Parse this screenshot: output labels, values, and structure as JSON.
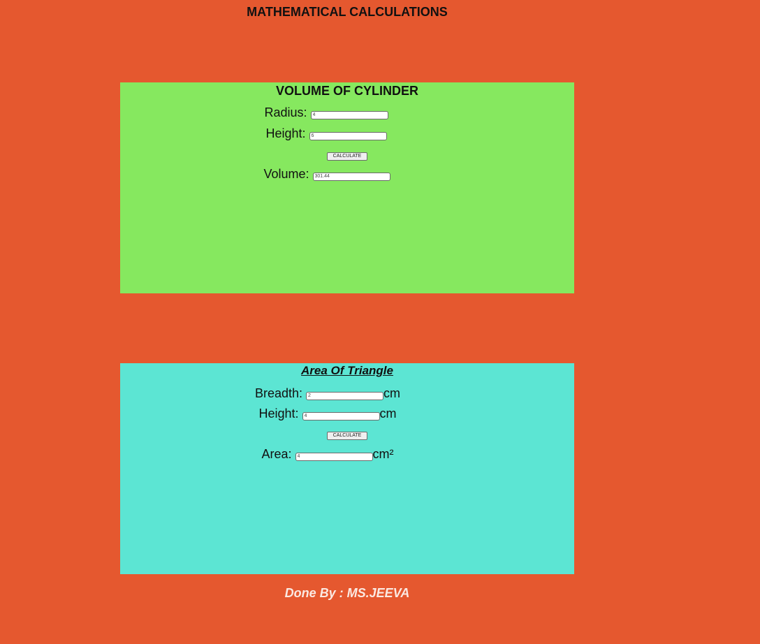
{
  "page": {
    "title": "MATHEMATICAL CALCULATIONS",
    "footer": "Done By : MS.JEEVA"
  },
  "cylinder": {
    "title": "VOLUME OF CYLINDER",
    "radius_label": "Radius:",
    "radius_value": "4",
    "height_label": "Height:",
    "height_value": "6",
    "button_label": "CALCULATE",
    "volume_label": "Volume:",
    "volume_value": "301.44",
    "background": "#86e85f"
  },
  "triangle": {
    "title": "Area Of Triangle",
    "breadth_label": "Breadth:",
    "breadth_value": "2",
    "breadth_unit": "cm",
    "height_label": "Height:",
    "height_value": "4",
    "height_unit": "cm",
    "button_label": "CALCULATE",
    "area_label": "Area:",
    "area_value": "4",
    "area_unit": "cm²",
    "background": "#5ce5d3"
  },
  "colors": {
    "page_background": "#e5582f",
    "footer_text": "#fbe9e2"
  }
}
